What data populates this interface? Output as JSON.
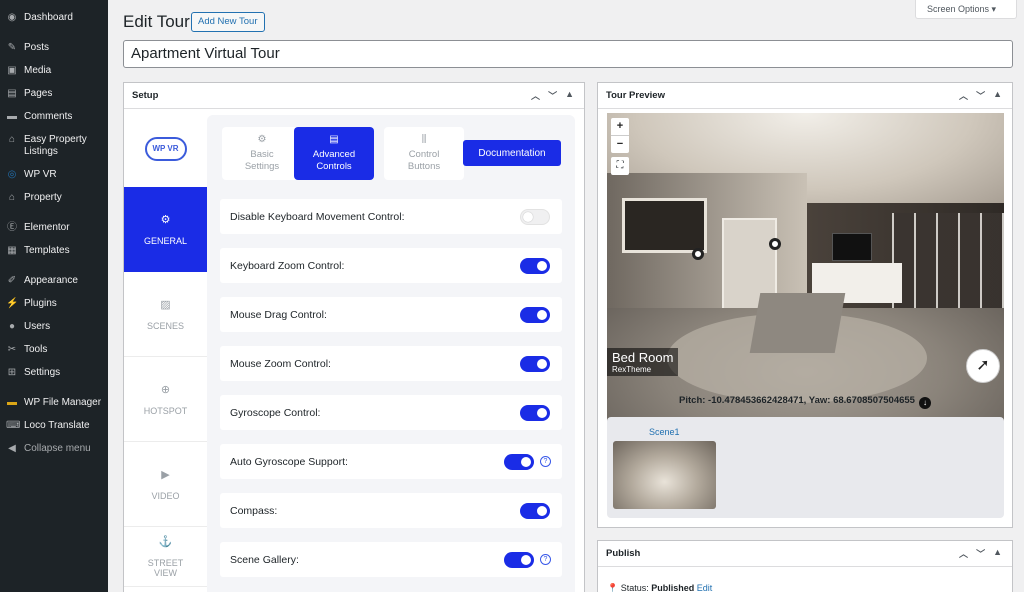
{
  "sidebar": {
    "items": [
      {
        "label": "Dashboard",
        "icon": "dashboard-icon"
      },
      {
        "label": "Posts",
        "icon": "pin-icon"
      },
      {
        "label": "Media",
        "icon": "media-icon"
      },
      {
        "label": "Pages",
        "icon": "page-icon"
      },
      {
        "label": "Comments",
        "icon": "comment-icon"
      },
      {
        "label": "Easy Property Listings",
        "icon": "easy-property-icon"
      },
      {
        "label": "WP VR",
        "icon": "vr-icon"
      },
      {
        "label": "Property",
        "icon": "property-icon"
      },
      {
        "label": "Elementor",
        "icon": "elementor-icon"
      },
      {
        "label": "Templates",
        "icon": "templates-icon"
      },
      {
        "label": "Appearance",
        "icon": "brush-icon"
      },
      {
        "label": "Plugins",
        "icon": "plugin-icon"
      },
      {
        "label": "Users",
        "icon": "users-icon"
      },
      {
        "label": "Tools",
        "icon": "wrench-icon"
      },
      {
        "label": "Settings",
        "icon": "settings-icon"
      },
      {
        "label": "WP File Manager",
        "icon": "folder-icon"
      },
      {
        "label": "Loco Translate",
        "icon": "translate-icon"
      },
      {
        "label": "Collapse menu",
        "icon": "collapse-icon"
      }
    ]
  },
  "header": {
    "title": "Edit Tour",
    "add_new": "Add New Tour",
    "screen_options": "Screen Options ▾",
    "tour_title": "Apartment Virtual Tour"
  },
  "setup": {
    "title": "Setup",
    "logo_text": "WP VR",
    "vtabs": [
      "GENERAL",
      "SCENES",
      "HOTSPOT",
      "VIDEO",
      "STREET VIEW"
    ],
    "ctabs": [
      "Basic Settings",
      "Advanced Controls",
      "Control Buttons"
    ],
    "documentation": "Documentation",
    "options": [
      {
        "label": "Disable Keyboard Movement Control:",
        "on": false
      },
      {
        "label": "Keyboard Zoom Control:",
        "on": true
      },
      {
        "label": "Mouse Drag Control:",
        "on": true
      },
      {
        "label": "Mouse Zoom Control:",
        "on": true
      },
      {
        "label": "Gyroscope Control:",
        "on": true
      },
      {
        "label": "Auto Gyroscope Support:",
        "on": true
      },
      {
        "label": "Compass:",
        "on": true
      },
      {
        "label": "Scene Gallery:",
        "on": true
      }
    ]
  },
  "preview": {
    "title": "Tour Preview",
    "scene_title": "Bed Room",
    "scene_author": "RexTheme",
    "pitch_text": "Pitch: -10.478453662428471, Yaw: 68.6708507504655",
    "gallery_scene": "Scene1"
  },
  "publish": {
    "title": "Publish",
    "status_label": "Status:",
    "status_value": "Published",
    "edit": "Edit"
  },
  "colors": {
    "accent": "#1a2ce6",
    "sidebar_bg": "#1d2327",
    "link": "#2271b1"
  }
}
